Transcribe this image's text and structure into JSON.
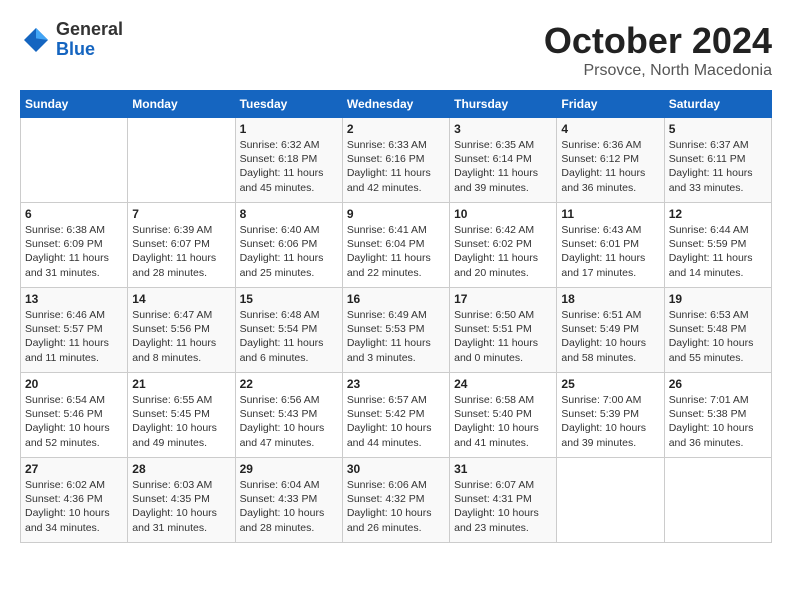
{
  "header": {
    "logo_general": "General",
    "logo_blue": "Blue",
    "month_title": "October 2024",
    "location": "Prsovce, North Macedonia"
  },
  "weekdays": [
    "Sunday",
    "Monday",
    "Tuesday",
    "Wednesday",
    "Thursday",
    "Friday",
    "Saturday"
  ],
  "weeks": [
    [
      {
        "day": "",
        "info": ""
      },
      {
        "day": "",
        "info": ""
      },
      {
        "day": "1",
        "sunrise": "6:32 AM",
        "sunset": "6:18 PM",
        "daylight": "11 hours and 45 minutes."
      },
      {
        "day": "2",
        "sunrise": "6:33 AM",
        "sunset": "6:16 PM",
        "daylight": "11 hours and 42 minutes."
      },
      {
        "day": "3",
        "sunrise": "6:35 AM",
        "sunset": "6:14 PM",
        "daylight": "11 hours and 39 minutes."
      },
      {
        "day": "4",
        "sunrise": "6:36 AM",
        "sunset": "6:12 PM",
        "daylight": "11 hours and 36 minutes."
      },
      {
        "day": "5",
        "sunrise": "6:37 AM",
        "sunset": "6:11 PM",
        "daylight": "11 hours and 33 minutes."
      }
    ],
    [
      {
        "day": "6",
        "sunrise": "6:38 AM",
        "sunset": "6:09 PM",
        "daylight": "11 hours and 31 minutes."
      },
      {
        "day": "7",
        "sunrise": "6:39 AM",
        "sunset": "6:07 PM",
        "daylight": "11 hours and 28 minutes."
      },
      {
        "day": "8",
        "sunrise": "6:40 AM",
        "sunset": "6:06 PM",
        "daylight": "11 hours and 25 minutes."
      },
      {
        "day": "9",
        "sunrise": "6:41 AM",
        "sunset": "6:04 PM",
        "daylight": "11 hours and 22 minutes."
      },
      {
        "day": "10",
        "sunrise": "6:42 AM",
        "sunset": "6:02 PM",
        "daylight": "11 hours and 20 minutes."
      },
      {
        "day": "11",
        "sunrise": "6:43 AM",
        "sunset": "6:01 PM",
        "daylight": "11 hours and 17 minutes."
      },
      {
        "day": "12",
        "sunrise": "6:44 AM",
        "sunset": "5:59 PM",
        "daylight": "11 hours and 14 minutes."
      }
    ],
    [
      {
        "day": "13",
        "sunrise": "6:46 AM",
        "sunset": "5:57 PM",
        "daylight": "11 hours and 11 minutes."
      },
      {
        "day": "14",
        "sunrise": "6:47 AM",
        "sunset": "5:56 PM",
        "daylight": "11 hours and 8 minutes."
      },
      {
        "day": "15",
        "sunrise": "6:48 AM",
        "sunset": "5:54 PM",
        "daylight": "11 hours and 6 minutes."
      },
      {
        "day": "16",
        "sunrise": "6:49 AM",
        "sunset": "5:53 PM",
        "daylight": "11 hours and 3 minutes."
      },
      {
        "day": "17",
        "sunrise": "6:50 AM",
        "sunset": "5:51 PM",
        "daylight": "11 hours and 0 minutes."
      },
      {
        "day": "18",
        "sunrise": "6:51 AM",
        "sunset": "5:49 PM",
        "daylight": "10 hours and 58 minutes."
      },
      {
        "day": "19",
        "sunrise": "6:53 AM",
        "sunset": "5:48 PM",
        "daylight": "10 hours and 55 minutes."
      }
    ],
    [
      {
        "day": "20",
        "sunrise": "6:54 AM",
        "sunset": "5:46 PM",
        "daylight": "10 hours and 52 minutes."
      },
      {
        "day": "21",
        "sunrise": "6:55 AM",
        "sunset": "5:45 PM",
        "daylight": "10 hours and 49 minutes."
      },
      {
        "day": "22",
        "sunrise": "6:56 AM",
        "sunset": "5:43 PM",
        "daylight": "10 hours and 47 minutes."
      },
      {
        "day": "23",
        "sunrise": "6:57 AM",
        "sunset": "5:42 PM",
        "daylight": "10 hours and 44 minutes."
      },
      {
        "day": "24",
        "sunrise": "6:58 AM",
        "sunset": "5:40 PM",
        "daylight": "10 hours and 41 minutes."
      },
      {
        "day": "25",
        "sunrise": "7:00 AM",
        "sunset": "5:39 PM",
        "daylight": "10 hours and 39 minutes."
      },
      {
        "day": "26",
        "sunrise": "7:01 AM",
        "sunset": "5:38 PM",
        "daylight": "10 hours and 36 minutes."
      }
    ],
    [
      {
        "day": "27",
        "sunrise": "6:02 AM",
        "sunset": "4:36 PM",
        "daylight": "10 hours and 34 minutes."
      },
      {
        "day": "28",
        "sunrise": "6:03 AM",
        "sunset": "4:35 PM",
        "daylight": "10 hours and 31 minutes."
      },
      {
        "day": "29",
        "sunrise": "6:04 AM",
        "sunset": "4:33 PM",
        "daylight": "10 hours and 28 minutes."
      },
      {
        "day": "30",
        "sunrise": "6:06 AM",
        "sunset": "4:32 PM",
        "daylight": "10 hours and 26 minutes."
      },
      {
        "day": "31",
        "sunrise": "6:07 AM",
        "sunset": "4:31 PM",
        "daylight": "10 hours and 23 minutes."
      },
      {
        "day": "",
        "info": ""
      },
      {
        "day": "",
        "info": ""
      }
    ]
  ],
  "labels": {
    "sunrise": "Sunrise:",
    "sunset": "Sunset:",
    "daylight": "Daylight:"
  }
}
